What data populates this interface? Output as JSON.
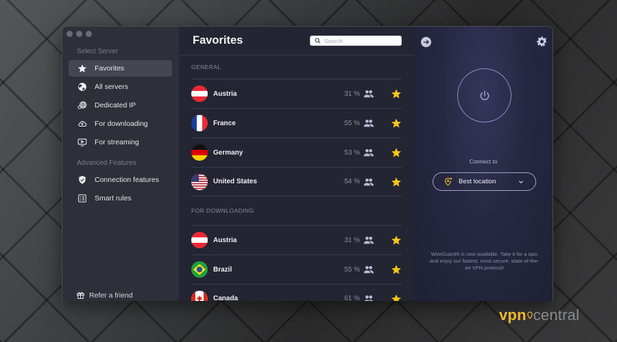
{
  "sidebar": {
    "section_select": "Select Server",
    "section_advanced": "Advanced Features",
    "items": [
      {
        "label": "Favorites",
        "icon": "star-icon",
        "active": true
      },
      {
        "label": "All servers",
        "icon": "globe-icon"
      },
      {
        "label": "Dedicated IP",
        "icon": "dedicated-ip-globe-icon"
      },
      {
        "label": "For downloading",
        "icon": "cloud-download-icon"
      },
      {
        "label": "For streaming",
        "icon": "tv-play-icon"
      }
    ],
    "advanced_items": [
      {
        "label": "Connection features",
        "icon": "shield-check-icon"
      },
      {
        "label": "Smart rules",
        "icon": "rules-list-icon"
      }
    ],
    "refer": "Refer a friend"
  },
  "list": {
    "title": "Favorites",
    "search_placeholder": "Search",
    "groups": [
      {
        "label": "GENERAL",
        "rows": [
          {
            "country": "Austria",
            "load": "31 %",
            "flag": "austria"
          },
          {
            "country": "France",
            "load": "55 %",
            "flag": "france"
          },
          {
            "country": "Germany",
            "load": "53 %",
            "flag": "germany"
          },
          {
            "country": "United States",
            "load": "54 %",
            "flag": "usa"
          }
        ]
      },
      {
        "label": "FOR DOWNLOADING",
        "rows": [
          {
            "country": "Austria",
            "load": "31 %",
            "flag": "austria"
          },
          {
            "country": "Brazil",
            "load": "55 %",
            "flag": "brazil"
          },
          {
            "country": "Canada",
            "load": "61 %",
            "flag": "canada"
          }
        ]
      }
    ]
  },
  "connect": {
    "label": "Connect to",
    "location": "Best location",
    "promo": "WireGuard® is now available. Take it for a spin and enjoy our fastest, most secure, state-of-the-art VPN protocol!"
  },
  "colors": {
    "accent_star": "#f5c518",
    "power_ring": "#8c8fce"
  },
  "watermark": {
    "brand_left": "vpn",
    "brand_right": "central"
  }
}
